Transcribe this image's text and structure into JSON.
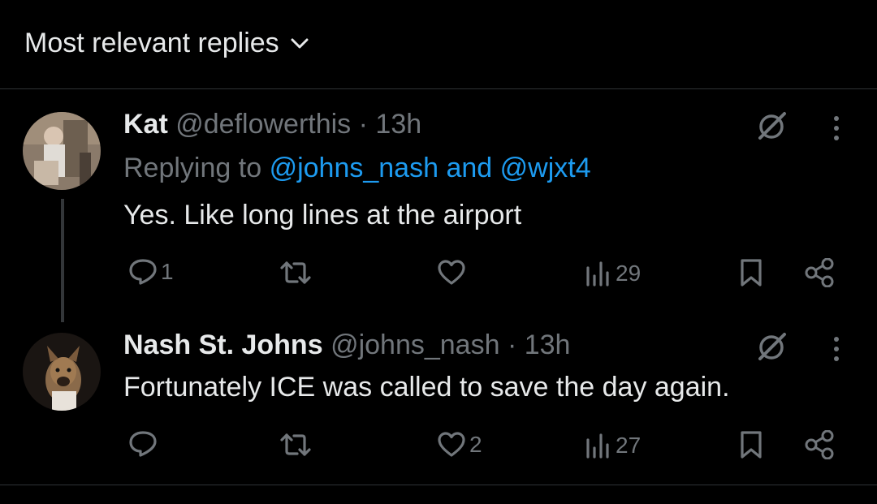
{
  "sort": {
    "label": "Most relevant replies",
    "icon": "chevron-down-icon"
  },
  "posts": [
    {
      "author_name": "Kat",
      "handle": "@deflowerthis",
      "separator": "·",
      "time": "13h",
      "replying_prefix": "Replying to",
      "replying_user_1": "@johns_nash",
      "replying_and": "and",
      "replying_user_2": "@wjxt4",
      "text": "Yes. Like long lines at the airport",
      "replies": "1",
      "retweets": "",
      "likes": "",
      "views": "29"
    },
    {
      "author_name": "Nash St. Johns",
      "handle": "@johns_nash",
      "separator": "·",
      "time": "13h",
      "text": "Fortunately ICE was called to save the day again.",
      "replies": "",
      "retweets": "",
      "likes": "2",
      "views": "27"
    }
  ],
  "colors": {
    "background": "#000000",
    "text": "#e7e9ea",
    "muted": "#71767b",
    "link": "#1d9bf0",
    "divider": "#2f3336"
  }
}
